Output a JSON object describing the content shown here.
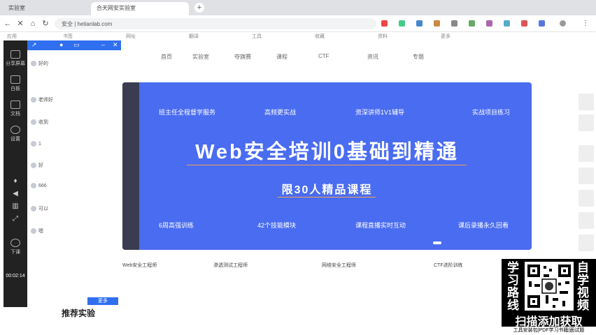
{
  "browser": {
    "tabs": [
      "实验室",
      "合天网安实验室"
    ],
    "address": "安全 | hetianlab.com",
    "bookmarks": [
      "应用",
      "书签",
      "网址",
      "翻译",
      "工具",
      "收藏",
      "资料",
      "更多"
    ]
  },
  "rail": {
    "items": [
      "分享屏幕",
      "白板",
      "文档",
      "设置"
    ],
    "bottom_label": "下课",
    "timer": "00:02:14"
  },
  "chat": {
    "messages": [
      "好的",
      "老师好",
      "收到",
      "1",
      "好",
      "666",
      "可以",
      "嗯"
    ]
  },
  "site": {
    "nav": [
      "首页",
      "实验室",
      "夺旗赛",
      "课程",
      "CTF",
      "资讯",
      "专题"
    ]
  },
  "banner": {
    "features_top": [
      "班主任全程督学服务",
      "高频更实战",
      "资深讲师1V1辅导",
      "实战项目练习"
    ],
    "title": "Web安全培训0基础到精通",
    "subtitle": "限30人精品课程",
    "features_bottom": [
      "6周高强训练",
      "42个技能模块",
      "课程直播实时互动",
      "课后录播永久回看"
    ]
  },
  "courses": [
    "Web安全工程师",
    "渗透测试工程师",
    "网络安全工程师",
    "CTF进阶训练"
  ],
  "recommend": {
    "title": "推荐实验",
    "button": "更多"
  },
  "promo": {
    "left_chars": [
      "学",
      "习",
      "路",
      "线"
    ],
    "right_chars": [
      "自",
      "学",
      "视",
      "频"
    ],
    "cta": "扫描添加获取",
    "footer": "工具安装包|PDF学习书籍|面试题"
  }
}
